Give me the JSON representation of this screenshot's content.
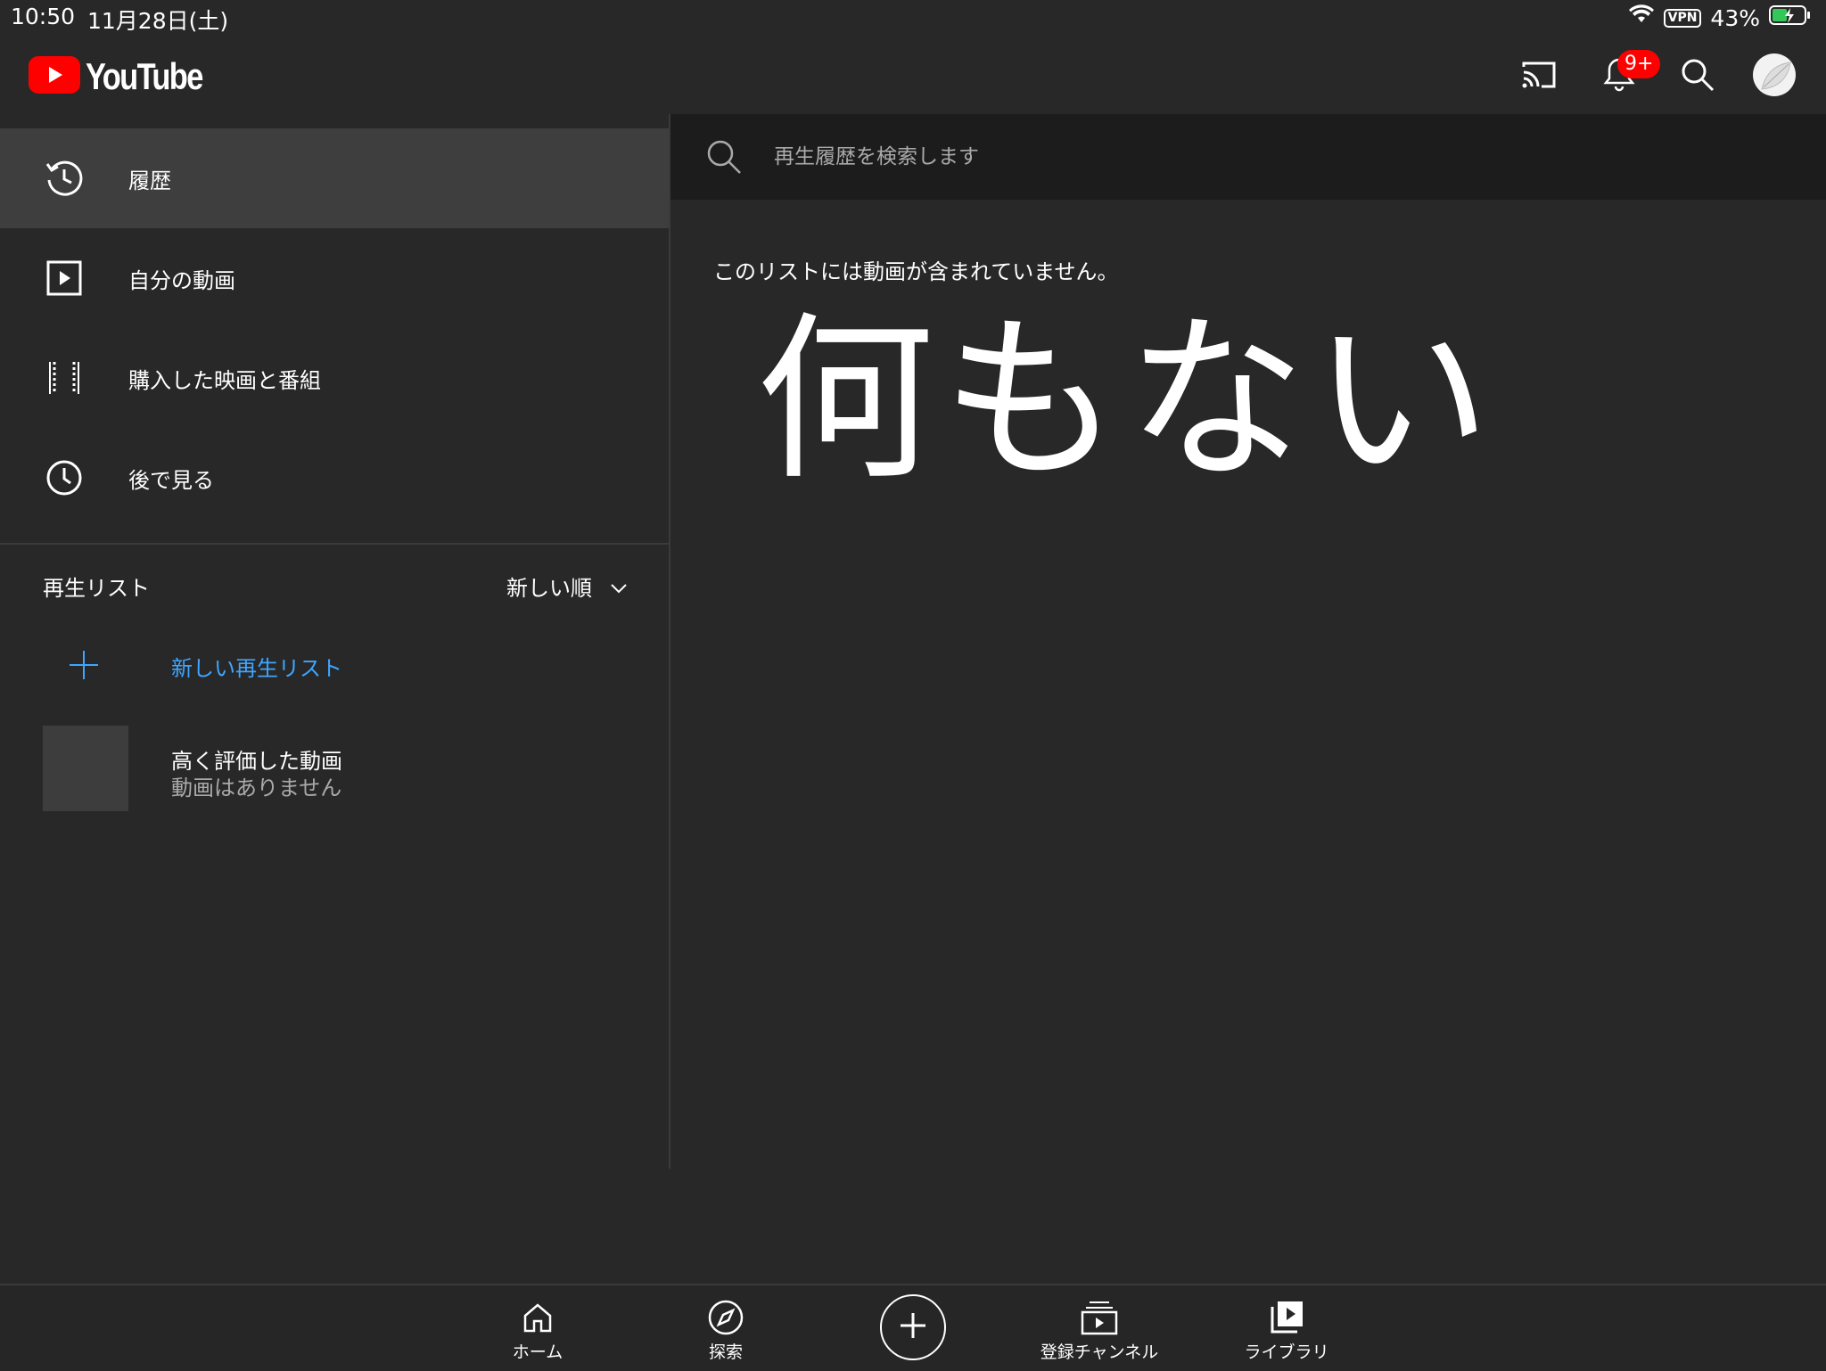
{
  "status_bar": {
    "time": "10:50",
    "date": "11月28日(土)",
    "vpn": "VPN",
    "battery": "43%"
  },
  "header": {
    "logo_text": "YouTube",
    "notification_badge": "9+",
    "icons": [
      "cast-icon",
      "bell-icon",
      "search-icon",
      "avatar"
    ]
  },
  "sidebar": {
    "items": [
      {
        "label": "履歴",
        "icon": "history-icon",
        "active": true
      },
      {
        "label": "自分の動画",
        "icon": "my-videos-icon"
      },
      {
        "label": "購入した映画と番組",
        "icon": "film-icon"
      },
      {
        "label": "後で見る",
        "icon": "clock-icon"
      }
    ],
    "playlists_header": "再生リスト",
    "sort_label": "新しい順",
    "new_playlist_label": "新しい再生リスト",
    "liked_title": "高く評価した動画",
    "liked_subtitle": "動画はありません"
  },
  "main": {
    "search_placeholder": "再生履歴を検索します",
    "empty_message": "このリストには動画が含まれていません。",
    "big_text": "何もない"
  },
  "bottom_nav": {
    "tabs": [
      {
        "label": "ホーム",
        "icon": "home-icon"
      },
      {
        "label": "探索",
        "icon": "explore-icon"
      },
      {
        "label": "",
        "icon": "create-icon"
      },
      {
        "label": "登録チャンネル",
        "icon": "subscriptions-icon"
      },
      {
        "label": "ライブラリ",
        "icon": "library-icon"
      }
    ]
  },
  "colors": {
    "background": "#282828",
    "accent_blue": "#3ea6ff",
    "brand_red": "#ff0000",
    "battery_green": "#34c759"
  }
}
